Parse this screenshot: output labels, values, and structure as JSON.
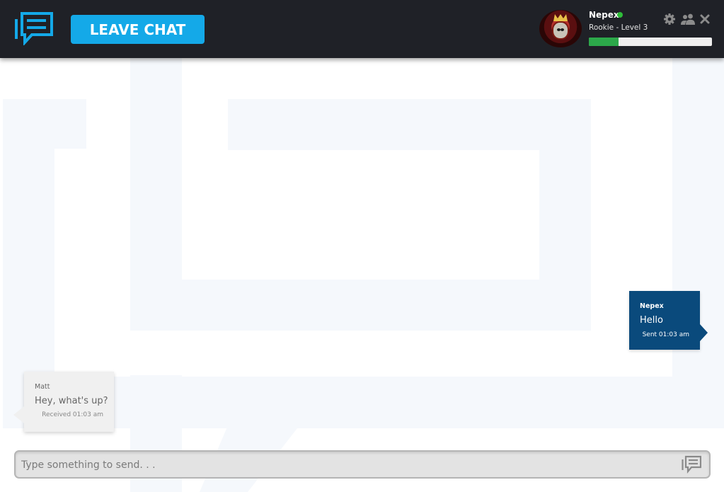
{
  "header": {
    "leave_label": "LEAVE CHAT",
    "user": {
      "name": "Nepex",
      "status_color": "#2ebd39",
      "level_text": "Rookie - Level 3",
      "progress_fraction": 0.24
    },
    "icons": [
      "gear-icon",
      "users-icon",
      "close-icon"
    ]
  },
  "messages": [
    {
      "direction": "sent",
      "author": "Nepex",
      "text": "Hello",
      "time": "Sent 01:03 am"
    },
    {
      "direction": "received",
      "author": "Matt",
      "text": "Hey, what's up?",
      "time": "Received 01:03 am"
    }
  ],
  "composer": {
    "placeholder": "Type something to send. . ."
  },
  "colors": {
    "header_bg": "#1f2127",
    "accent": "#14a9e8",
    "sent_bubble": "#0a4a7c",
    "received_bubble": "#f0f0f0",
    "progress": "#2ca84a"
  }
}
